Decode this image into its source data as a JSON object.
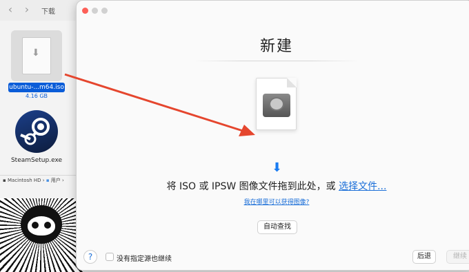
{
  "finder": {
    "title": "下载",
    "back_icon": "chevron-left-icon",
    "forward_icon": "chevron-right-icon",
    "files": [
      {
        "name": "ubuntu-...m64.iso",
        "size": "4.16 GB",
        "icon": "iso-file-icon",
        "selected": true
      },
      {
        "name": "SteamSetup.exe",
        "icon": "steam-logo-icon",
        "selected": false
      }
    ],
    "path": [
      "Macintosh HD",
      "用户"
    ]
  },
  "dialog": {
    "title": "新建",
    "drop_text": "将 ISO 或 IPSW 图像文件拖到此处，或 ",
    "choose_link": "选择文件...",
    "where_link": "我在哪里可以获得图像?",
    "auto_button": "自动查找",
    "help_button": "?",
    "checkbox_label": "没有指定源也继续",
    "checkbox_checked": false,
    "back_button": "后退",
    "continue_button": "继续",
    "continue_enabled": false
  },
  "colors": {
    "accent": "#1a6ed8",
    "annotation_arrow": "#e5462e",
    "close_button": "#fd5f57"
  }
}
